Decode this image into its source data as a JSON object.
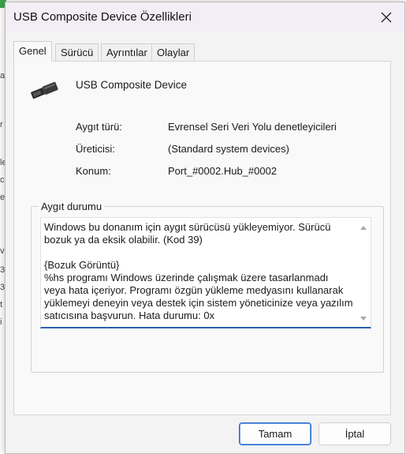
{
  "window": {
    "title": "USB Composite Device Özellikleri"
  },
  "tabs": [
    {
      "label": "Genel",
      "active": true
    },
    {
      "label": "Sürücü",
      "active": false
    },
    {
      "label": "Ayrıntılar",
      "active": false
    },
    {
      "label": "Olaylar",
      "active": false
    }
  ],
  "device": {
    "name": "USB Composite Device",
    "icon": "usb-plug-icon"
  },
  "properties": [
    {
      "label": "Aygıt türü:",
      "value": "Evrensel Seri Veri Yolu denetleyicileri"
    },
    {
      "label": "Üreticisi:",
      "value": "(Standard system devices)"
    },
    {
      "label": "Konum:",
      "value": "Port_#0002.Hub_#0002"
    }
  ],
  "status": {
    "group_label": "Aygıt durumu",
    "text": "Windows bu donanım için aygıt sürücüsü yükleyemiyor. Sürücü\nbozuk ya da eksik olabilir. (Kod 39)\n\n{Bozuk Görüntü}\n%hs programı Windows üzerinde çalışmak üzere tasarlanmadı\nveya hata içeriyor. Programı özgün yükleme medyasını kullanarak\nyüklemeyi deneyin veya destek için sistem yöneticinize veya yazılım\nsatıcısına başvurun. Hata durumu: 0x"
  },
  "buttons": {
    "ok": "Tamam",
    "cancel": "İptal"
  },
  "background_fragments": [
    "a",
    "r",
    "le",
    "c",
    "e",
    "v",
    "3.",
    "3.",
    "t",
    "i"
  ]
}
